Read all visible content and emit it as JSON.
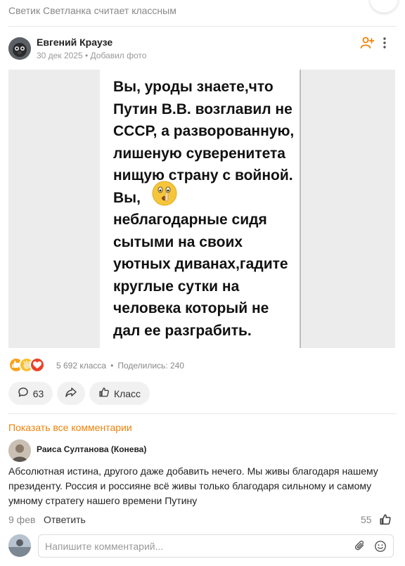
{
  "context": {
    "line": "Светик Светланка считает классным"
  },
  "post": {
    "author": "Евгений Краузе",
    "meta": "30 дек 2025 • Добавил фото",
    "image_text": "Вы, уроды знаете,что\nПутин В.В. возглавил не\nСССР, а разворованную,\nлишеную суверенитета\nнищую страну с войной.\nВы,\nнеблагодарные сидя\nсытыми на своих\nуютных диванах,гадите\nкруглые сутки на\nчеловека который не\nдал ее разграбить.",
    "classes": "5 692 класса",
    "shares": "Поделились: 240",
    "comments_count": "63",
    "class_label": "Класс"
  },
  "comments": {
    "show_all": "Показать все комментарии",
    "author": "Раиса Султанова (Конева)",
    "text": "Абсолютная истина, другого даже добавить нечего. Мы живы благодаря нашему президенту. Россия и россияне всё живы только благодаря сильному и самому умному стратегу нашего времени Путину",
    "date": "9 фев",
    "reply": "Ответить",
    "likes": "55"
  },
  "composer": {
    "placeholder": "Напишите комментарий..."
  },
  "colors": {
    "accent": "#ee8208",
    "muted": "#888888"
  }
}
